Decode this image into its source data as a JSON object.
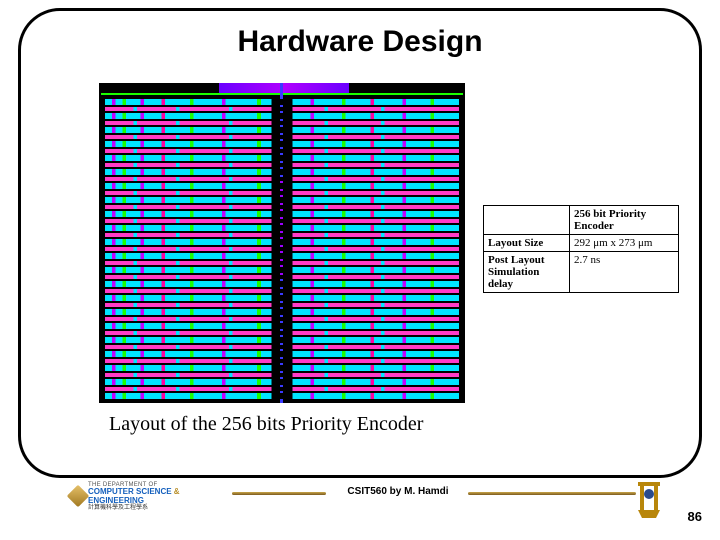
{
  "title": "Hardware Design",
  "caption": "Layout of the 256 bits Priority Encoder",
  "table": {
    "header_blank": "",
    "header_value": "256 bit Priority Encoder",
    "rows": [
      {
        "k": "Layout Size",
        "v": "292 μm x 273 μm"
      },
      {
        "k": "Post Layout Simulation delay",
        "v": "2.7 ns"
      }
    ]
  },
  "footer": "CSIT560 by M. Hamdi",
  "dept": {
    "line1": "THE DEPARTMENT OF",
    "line2_a": "COMPUTER ",
    "line2_b": "SCIENCE ",
    "line2_amp": "& ",
    "line2_c": "ENGINEERING",
    "line3": "計算機科學及工程學系"
  },
  "page": "86"
}
